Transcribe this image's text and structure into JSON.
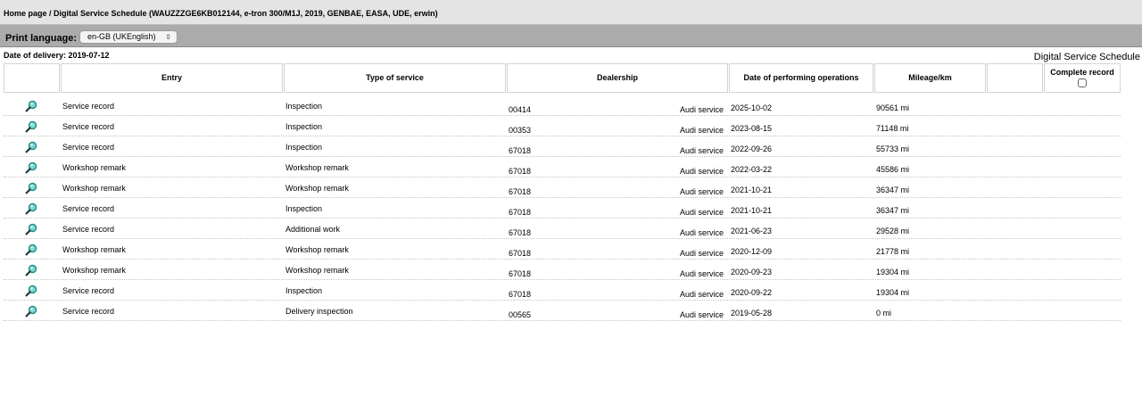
{
  "breadcrumb": "Home page / Digital Service Schedule (WAUZZZGE6KB012144, e-tron 300/M1J, 2019, GENBAE, EASA, UDE, erwin)",
  "toolbar": {
    "print_language_label": "Print language:",
    "language_value": "en-GB (UKEnglish)",
    "title": "Digital Service Schedule"
  },
  "delivery_date": "Date of delivery: 2019-07-12",
  "columns": {
    "entry": "Entry",
    "type": "Type of service",
    "dealership": "Dealership",
    "date": "Date of performing operations",
    "mileage": "Mileage/km",
    "extra": "",
    "complete_record": "Complete record"
  },
  "rows": [
    {
      "entry": "Service record",
      "type": "Inspection",
      "dealer_code": "00414",
      "dealer_name": "Audi service",
      "date": "2025-10-02",
      "mileage": "90561 mi"
    },
    {
      "entry": "Service record",
      "type": "Inspection",
      "dealer_code": "00353",
      "dealer_name": "Audi service",
      "date": "2023-08-15",
      "mileage": "71148 mi"
    },
    {
      "entry": "Service record",
      "type": "Inspection",
      "dealer_code": "67018",
      "dealer_name": "Audi service",
      "date": "2022-09-26",
      "mileage": "55733 mi"
    },
    {
      "entry": "Workshop remark",
      "type": "Workshop remark",
      "dealer_code": "67018",
      "dealer_name": "Audi service",
      "date": "2022-03-22",
      "mileage": "45586 mi"
    },
    {
      "entry": "Workshop remark",
      "type": "Workshop remark",
      "dealer_code": "67018",
      "dealer_name": "Audi service",
      "date": "2021-10-21",
      "mileage": "36347 mi"
    },
    {
      "entry": "Service record",
      "type": "Inspection",
      "dealer_code": "67018",
      "dealer_name": "Audi service",
      "date": "2021-10-21",
      "mileage": "36347 mi"
    },
    {
      "entry": "Service record",
      "type": "Additional work",
      "dealer_code": "67018",
      "dealer_name": "Audi service",
      "date": "2021-06-23",
      "mileage": "29528 mi"
    },
    {
      "entry": "Workshop remark",
      "type": "Workshop remark",
      "dealer_code": "67018",
      "dealer_name": "Audi service",
      "date": "2020-12-09",
      "mileage": "21778 mi"
    },
    {
      "entry": "Workshop remark",
      "type": "Workshop remark",
      "dealer_code": "67018",
      "dealer_name": "Audi service",
      "date": "2020-09-23",
      "mileage": "19304 mi"
    },
    {
      "entry": "Service record",
      "type": "Inspection",
      "dealer_code": "67018",
      "dealer_name": "Audi service",
      "date": "2020-09-22",
      "mileage": "19304 mi"
    },
    {
      "entry": "Service record",
      "type": "Delivery inspection",
      "dealer_code": "00565",
      "dealer_name": "Audi service",
      "date": "2019-05-28",
      "mileage": "0 mi"
    }
  ],
  "icons": {
    "row_action": "magnifier-icon",
    "language_select": "chevron-updown-icon"
  },
  "colors": {
    "topbar": "#e4e4e4",
    "toolbar": "#ababab",
    "magnifier_lens": "#2aa8a0"
  }
}
